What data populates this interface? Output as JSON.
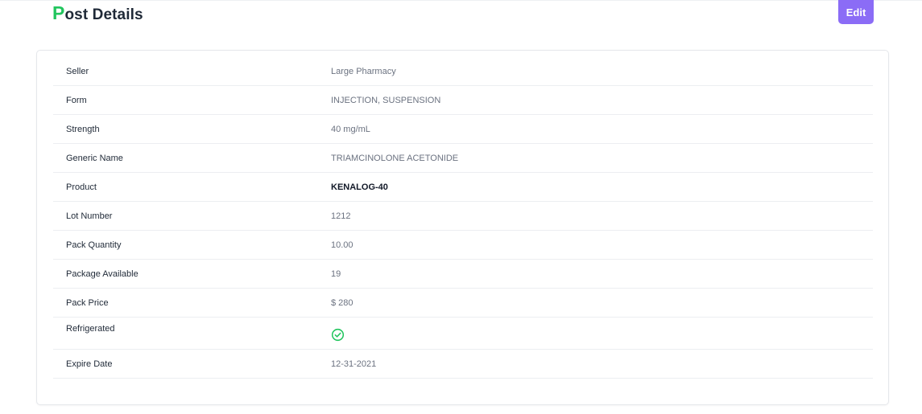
{
  "header": {
    "title_first_letter": "P",
    "title_rest": "ost Details",
    "edit_label": "Edit",
    "accent_color": "#22c55e",
    "button_color": "#8b6cf6"
  },
  "details": [
    {
      "label": "Seller",
      "value": "Large Pharmacy"
    },
    {
      "label": "Form",
      "value": "INJECTION, SUSPENSION"
    },
    {
      "label": "Strength",
      "value": "40 mg/mL"
    },
    {
      "label": "Generic Name",
      "value": "TRIAMCINOLONE ACETONIDE"
    },
    {
      "label": "Product",
      "value": "KENALOG-40"
    },
    {
      "label": "Lot Number",
      "value": "1212"
    },
    {
      "label": "Pack Quantity",
      "value": "10.00"
    },
    {
      "label": "Package Available",
      "value": "19"
    },
    {
      "label": "Pack Price",
      "value": "$ 280"
    },
    {
      "label": "Refrigerated",
      "value_icon": "check-circle-icon",
      "checked": true
    },
    {
      "label": "Expire Date",
      "value": "12-31-2021"
    }
  ]
}
